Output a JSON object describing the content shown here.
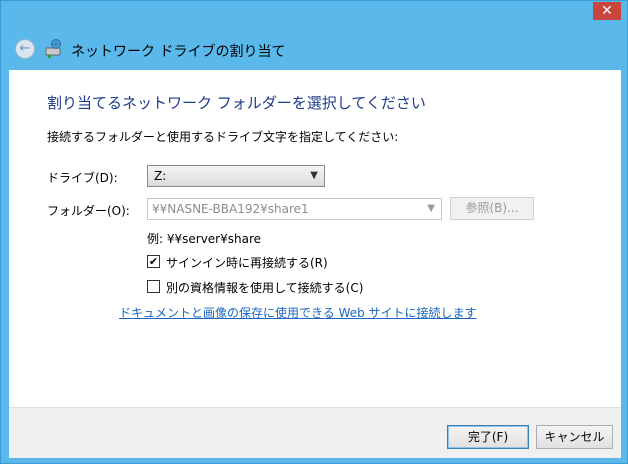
{
  "window": {
    "close_symbol": "✕",
    "title": "ネットワーク ドライブの割り当て"
  },
  "icons": {
    "back": "back-arrow-icon",
    "network_drive": "network-drive-icon",
    "close": "close-icon",
    "dropdown": "chevron-down-icon",
    "checkbox_mark": "✔"
  },
  "content": {
    "heading": "割り当てるネットワーク フォルダーを選択してください",
    "instruction": "接続するフォルダーと使用するドライブ文字を指定してください:",
    "drive_label": "ドライブ(D):",
    "drive_value": "Z:",
    "folder_label": "フォルダー(O):",
    "folder_value": "¥¥NASNE-BBA192¥share1",
    "browse_label": "参照(B)...",
    "example": "例: ¥¥server¥share",
    "reconnect_label": "サインイン時に再接続する(R)",
    "reconnect_checked": true,
    "other_credentials_label": "別の資格情報を使用して接続する(C)",
    "other_credentials_checked": false,
    "link_text": "ドキュメントと画像の保存に使用できる Web サイトに接続します"
  },
  "footer": {
    "finish_label": "完了(F)",
    "cancel_label": "キャンセル"
  },
  "colors": {
    "titlebar": "#5ab8ea",
    "heading": "#1e3c8a",
    "link": "#1a65c0",
    "close": "#c9463d"
  }
}
